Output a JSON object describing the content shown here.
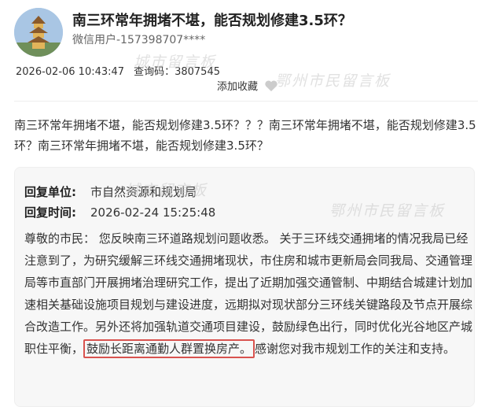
{
  "post": {
    "title": "南三环常年拥堵不堪，能否规划修建3.5环？",
    "author": "微信用户-157398707****",
    "date": "2026-02-06 10:43:47",
    "query_code_label": "查询码：",
    "query_code": "3807545",
    "favorite_label": "添加收藏",
    "content": "南三环常年拥堵不堪，能否规划修建3.5环？？？南三环常年拥堵不堪，能否规划修建3.5环？南三环常年拥堵不堪，能否规划修建3.5环？"
  },
  "watermarks": [
    "鄂州市民留言板",
    "城市留言板"
  ],
  "reply": {
    "unit_label": "回复单位:",
    "unit": "市自然资源和规划局",
    "time_label": "回复时间:",
    "time": "2026-02-24 15:25:48",
    "body_before": "尊敬的市民： 您反映南三环道路规划问题收悉。 关于三环线交通拥堵的情况我局已经注意到了，为研究缓解三环线交通拥堵现状，市住房和城市更新局会同我局、交通管理局等市直部门开展拥堵治理研究工作，提出了近期加强交通管制、中期结合城建计划加速相关基础设施项目规划与建设进度，远期拟对现状部分三环线关键路段及节点开展综合改造工作。另外还将加强轨道交通项目建设，鼓励绿色出行，同时优化光谷地区产城职住平衡，",
    "body_highlight": "鼓励长距离通勤人群置换房产。",
    "body_after": "感谢您对我市规划工作的关注和支持。"
  },
  "colors": {
    "highlight_border": "#d9534f",
    "reply_bg": "#f7f7f7"
  },
  "icons": {
    "favorite": "heart-icon"
  }
}
